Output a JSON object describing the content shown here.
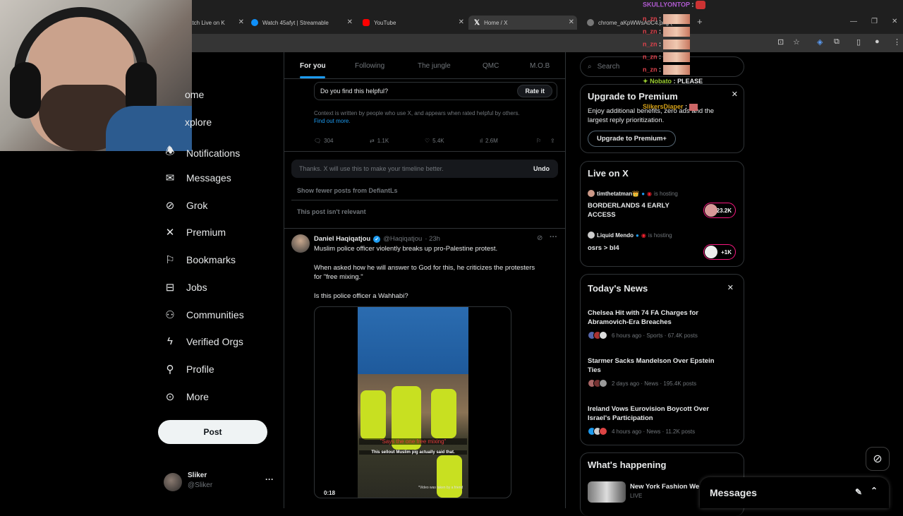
{
  "browser": {
    "tabs": [
      {
        "label": "atch Live on K",
        "icon_color": "#888888"
      },
      {
        "label": "Watch 45afyt | Streamable",
        "icon_color": "#0f90fa"
      },
      {
        "label": "YouTube",
        "icon_color": "#ff0000"
      },
      {
        "label": "Home / X",
        "icon_color": "#ffffff"
      },
      {
        "label": "chrome_aKpWWsA0C4.png (",
        "icon_color": "#aaaaaa"
      }
    ],
    "new_tab": "+"
  },
  "chat": [
    {
      "user": "SKULLYONTOP",
      "sep": ":",
      "color": "#b05ad1"
    },
    {
      "user": "n_zn",
      "sep": ":",
      "color": "#e0424c"
    },
    {
      "user": "n_zn",
      "sep": ":",
      "color": "#e0424c"
    },
    {
      "user": "n_zn",
      "sep": ":",
      "color": "#e0424c"
    },
    {
      "user": "n_zn",
      "sep": ":",
      "color": "#e0424c"
    },
    {
      "user": "n_zn",
      "sep": ":",
      "color": "#e0424c"
    },
    {
      "user": "Nobato",
      "sep": ":",
      "msg": "PLEASE",
      "color": "#9acd32"
    },
    {
      "user": "SlikersDiaper",
      "sep": ":",
      "color": "#d4a017"
    }
  ],
  "nav": {
    "items": [
      {
        "label": "ome",
        "icon": "home-icon"
      },
      {
        "label": "xplore",
        "icon": "search-icon"
      },
      {
        "label": "Notifications",
        "icon": "bell-icon"
      },
      {
        "label": "Messages",
        "icon": "mail-icon"
      },
      {
        "label": "Grok",
        "icon": "grok-icon"
      },
      {
        "label": "Premium",
        "icon": "x-logo-icon"
      },
      {
        "label": "Bookmarks",
        "icon": "bookmark-icon"
      },
      {
        "label": "Jobs",
        "icon": "briefcase-icon"
      },
      {
        "label": "Communities",
        "icon": "people-icon"
      },
      {
        "label": "Verified Orgs",
        "icon": "lightning-icon"
      },
      {
        "label": "Profile",
        "icon": "person-icon"
      },
      {
        "label": "More",
        "icon": "more-circle-icon"
      }
    ],
    "post_label": "Post",
    "account": {
      "name": "Sliker",
      "handle": "@Sliker",
      "more": "···"
    }
  },
  "main": {
    "tabs": [
      "For you",
      "Following",
      "The jungle",
      "QMC",
      "M.O.B"
    ],
    "note": {
      "question": "Do you find this helpful?",
      "rate_label": "Rate it",
      "context_text": "Context is written by people who use X, and appears when rated helpful by others.",
      "find_out_more": "Find out more."
    },
    "metrics": {
      "replies": "304",
      "reposts": "1.1K",
      "likes": "5.4K",
      "views": "2.6M"
    },
    "feedback": {
      "thanks": "Thanks. X will use this to make your timeline better.",
      "undo": "Undo",
      "show_fewer": "Show fewer posts from DefiantLs",
      "not_relevant": "This post isn't relevant"
    },
    "tweet": {
      "author": "Daniel Haqiqatjou",
      "handle": "@Haqiqatjou",
      "time": "· 23h",
      "line1": "Muslim police officer violently breaks up pro-Palestine protest.",
      "line2a": "When asked how he will answer to God for this, he criticizes the protesters",
      "line2b": "for \"free mixing.\"",
      "line3": "Is this police officer a Wahhabi?",
      "caption_red": "\"Says the one free mixing\"",
      "caption_white": "This sellout Muslim pig actually said that.",
      "video_credit": "*Video was taken by a friend",
      "duration": "0:18"
    }
  },
  "right": {
    "search_placeholder": "Search",
    "premium": {
      "title": "Upgrade to Premium",
      "desc_line1": "Enjoy additional benefits, zero ads and the",
      "desc_line2": "largest reply prioritization.",
      "button": "Upgrade to Premium+"
    },
    "live": {
      "title": "Live on X",
      "items": [
        {
          "host": "timthetatman👑",
          "hosting": "is hosting",
          "title_line1": "BORDERLANDS 4 EARLY",
          "title_line2": "ACCESS",
          "count": "+23.2K"
        },
        {
          "host": "Liquid Mendo",
          "hosting": "is hosting",
          "title_line1": "osrs > bl4",
          "title_line2": "",
          "count": "+1K"
        }
      ]
    },
    "news": {
      "title": "Today's News",
      "items": [
        {
          "line1": "Chelsea Hit with 74 FA Charges for",
          "line2": "Abramovich-Era Breaches",
          "meta": "6 hours ago · Sports · 67.4K posts"
        },
        {
          "line1": "Starmer Sacks Mandelson Over Epstein",
          "line2": "Ties",
          "meta": "2 days ago · News · 195.4K posts"
        },
        {
          "line1": "Ireland Vows Eurovision Boycott Over",
          "line2": "Israel's Participation",
          "meta": "4 hours ago · News · 11.2K posts"
        }
      ]
    },
    "happening": {
      "title": "What's happening",
      "item": "New York Fashion We",
      "item_meta": "LIVE"
    },
    "messages_label": "Messages"
  }
}
